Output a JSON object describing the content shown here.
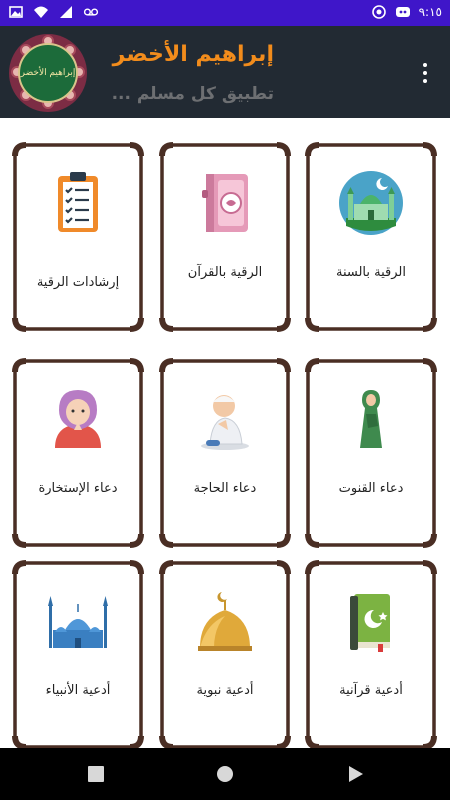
{
  "status_bar": {
    "time": "٩:١٥",
    "icons": [
      "image-icon",
      "wifi-icon",
      "signal-icon",
      "voicemail-icon",
      "settings-icon",
      "battery-icon"
    ]
  },
  "header": {
    "title": "إبراهيم الأخضر",
    "subtitle": "تطبيق كل مسلم ...",
    "logo_text": "إبراهيم الأخضر",
    "title_color": "#f28c1c",
    "background": "#222a33"
  },
  "colors": {
    "status_bar": "#3f16c9",
    "card_border": "#4a2e24",
    "nav_bar": "#000000"
  },
  "cards": [
    {
      "label": "الرقية بالسنة",
      "icon": "mosque-sunnah-icon"
    },
    {
      "label": "الرقية بالقرآن",
      "icon": "quran-book-icon"
    },
    {
      "label": "إرشادات الرقية",
      "icon": "clipboard-checklist-icon"
    },
    {
      "label": "دعاء القنوت",
      "icon": "praying-woman-icon"
    },
    {
      "label": "دعاء الحاجة",
      "icon": "praying-boy-icon"
    },
    {
      "label": "دعاء الإستخارة",
      "icon": "praying-girl-icon"
    },
    {
      "label": "أدعية قرآنية",
      "icon": "green-quran-icon"
    },
    {
      "label": "أدعية نبوية",
      "icon": "golden-dome-icon"
    },
    {
      "label": "أدعية الأنبياء",
      "icon": "blue-mosque-icon"
    }
  ],
  "nav": {
    "buttons": [
      "recents-button",
      "home-button",
      "back-button"
    ]
  }
}
